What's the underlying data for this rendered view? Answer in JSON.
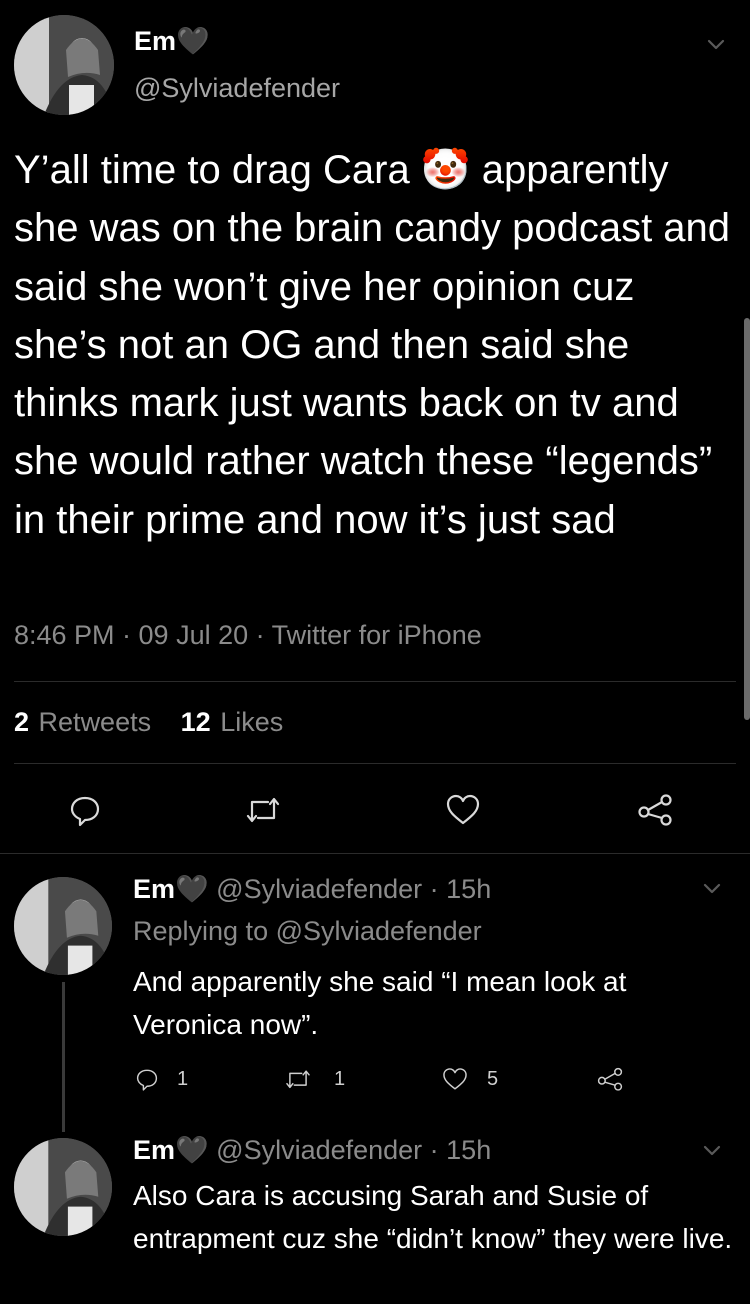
{
  "main_tweet": {
    "display_name": "Em🖤",
    "handle": "@Sylviadefender",
    "text": "Y’all time to drag Cara 🤡 apparently she was on the brain candy podcast and said she won’t give her opinion cuz she’s not an OG and then said she thinks mark just wants back on tv and she would rather watch these “legends” in their prime and now it’s just sad",
    "meta": "8:46 PM · 09 Jul 20 · Twitter for iPhone",
    "retweets_count": "2",
    "retweets_label": "Retweets",
    "likes_count": "12",
    "likes_label": "Likes"
  },
  "replies": [
    {
      "display_name": "Em🖤",
      "handle_time": "@Sylviadefender · 15h",
      "replying_prefix": "Replying to",
      "replying_to": "@Sylviadefender",
      "text": "And apparently she said “I mean look at Veronica now”.",
      "reply_count": "1",
      "retweet_count": "1",
      "like_count": "5"
    },
    {
      "display_name": "Em🖤",
      "handle_time": "@Sylviadefender · 15h",
      "text": "Also Cara is accusing Sarah and Susie of entrapment cuz she “didn’t know” they were live."
    }
  ],
  "icons": {
    "reply": "reply-icon",
    "retweet": "retweet-icon",
    "like": "heart-icon",
    "share": "share-icon",
    "more": "chevron-down-icon"
  },
  "colors": {
    "background": "#000000",
    "text": "#ffffff",
    "muted": "#8b8b8b",
    "divider": "#2b2b2b"
  }
}
